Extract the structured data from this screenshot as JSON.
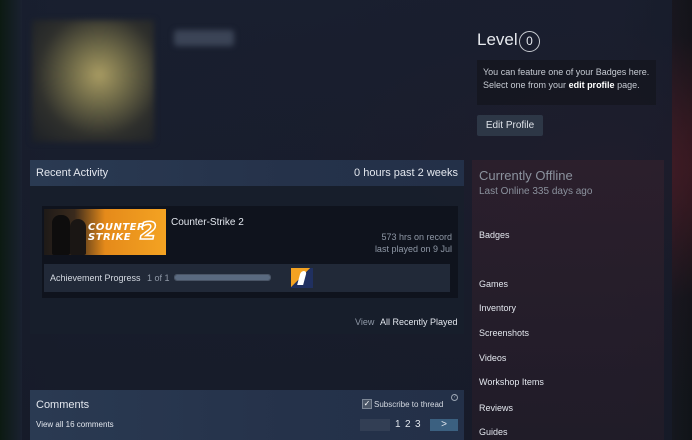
{
  "profile": {
    "level_label": "Level",
    "level_value": "0",
    "feature_text_1": "You can feature one of your Badges here.",
    "feature_text_2": "Select one from your",
    "feature_link": "edit profile",
    "feature_text_3": "page.",
    "edit_button": "Edit Profile"
  },
  "recent_activity": {
    "title": "Recent Activity",
    "hours_summary": "0 hours past 2 weeks",
    "game": {
      "name": "Counter-Strike 2",
      "capsule_text_1": "COUNTER",
      "capsule_text_2": "STRIKE",
      "capsule_number": "2",
      "hours_on_record": "573 hrs on record",
      "last_played": "last played on 9 Jul",
      "achievement_label": "Achievement Progress",
      "achievement_count": "1 of 1",
      "achievement_progress": 1.0
    },
    "view_label": "View",
    "view_link": "All Recently Played"
  },
  "comments": {
    "title": "Comments",
    "subscribe_label": "Subscribe to thread",
    "help_mark": "?",
    "view_all": "View all 16 comments",
    "pages": [
      "1",
      "2",
      "3"
    ],
    "next_label": ">"
  },
  "status": {
    "title": "Currently Offline",
    "last_online": "Last Online 335 days ago"
  },
  "nav": {
    "badges": "Badges",
    "games": "Games",
    "inventory": "Inventory",
    "screenshots": "Screenshots",
    "videos": "Videos",
    "workshop": "Workshop Items",
    "reviews": "Reviews",
    "guides": "Guides"
  },
  "colors": {
    "accent_orange": "#f4a322",
    "panel_blue": "#2a3a52",
    "next_button": "#3b6080"
  },
  "icons": {
    "subscribe_check": "checkmark",
    "achievement": "cs2-achievement-icon"
  }
}
